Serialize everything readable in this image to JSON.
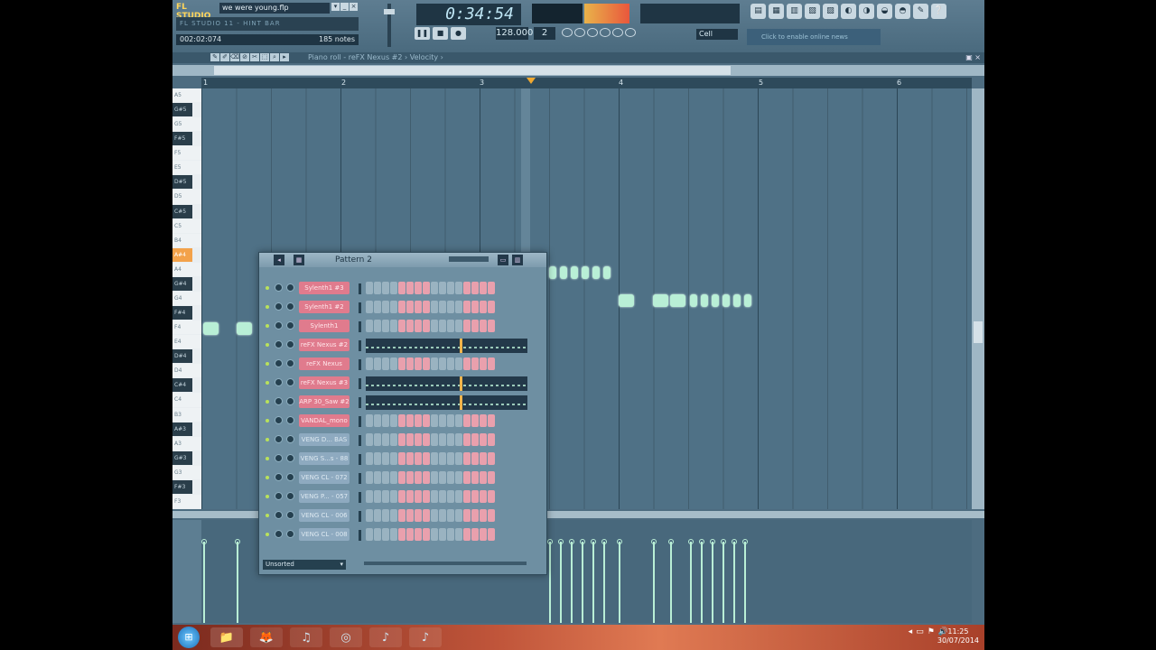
{
  "app": {
    "logo": "FL STUDIO",
    "project_file": "we were young.flp"
  },
  "hint": {
    "text": "FL STUDIO 11 - HINT BAR"
  },
  "position": {
    "time": "002:02:074",
    "notes": "185 notes"
  },
  "transport": {
    "clock": "0:34:54",
    "pause": "❚❚",
    "stop": "■",
    "record": "●",
    "tempo": "128.000",
    "pattern_num": "2"
  },
  "snap": {
    "label": "Cell"
  },
  "news": {
    "text": "Click to enable online news"
  },
  "toolbar_icons": [
    "▤",
    "▦",
    "▥",
    "▧",
    "▨",
    "◐",
    "◑",
    "◒",
    "◓",
    "✎",
    "❔"
  ],
  "piano_roll": {
    "title": "Piano roll - reFX Nexus #2 › Velocity ›",
    "ruler": [
      "1",
      "2",
      "3",
      "4",
      "5",
      "6"
    ]
  },
  "piano_keys": [
    "A5",
    "G#5",
    "G5",
    "F#5",
    "F5",
    "E5",
    "D#5",
    "D5",
    "C#5",
    "C5",
    "B4",
    "A#4",
    "A4",
    "G#4",
    "G4",
    "F#4",
    "F4",
    "E4",
    "D#4",
    "D4",
    "C#4",
    "C4",
    "B3",
    "A#3",
    "A3",
    "G#3",
    "G3",
    "F#3",
    "F3"
  ],
  "sequencer": {
    "title": "Pattern 2",
    "footer": "Unsorted",
    "channels": [
      {
        "name": "Sylenth1 #3",
        "type": "pink"
      },
      {
        "name": "Sylenth1 #2",
        "type": "pink"
      },
      {
        "name": "Sylenth1",
        "type": "pink"
      },
      {
        "name": "reFX Nexus #2",
        "type": "pink",
        "roll": true
      },
      {
        "name": "reFX Nexus",
        "type": "pink"
      },
      {
        "name": "reFX Nexus #3",
        "type": "pink",
        "roll": true
      },
      {
        "name": "ARP 30_Saw #2",
        "type": "pink",
        "roll": true
      },
      {
        "name": "VANDAL_mono",
        "type": "pink"
      },
      {
        "name": "VENG D... BAS",
        "type": "blue"
      },
      {
        "name": "VENG S...s - 88",
        "type": "blue"
      },
      {
        "name": "VENG CL - 072",
        "type": "blue"
      },
      {
        "name": "VENG P... - 057",
        "type": "blue"
      },
      {
        "name": "VENG CL - 006",
        "type": "blue"
      },
      {
        "name": "VENG CL - 008",
        "type": "blue"
      }
    ]
  },
  "taskbar": {
    "start": "⊞",
    "apps": [
      "📁",
      "🦊",
      "♫",
      "◎",
      "♪",
      "♪"
    ],
    "tray": [
      "◂",
      "▭",
      "⚑",
      "🔊"
    ],
    "time": "11:25",
    "date": "30/07/2014"
  },
  "colors": {
    "note": "#b9efd6",
    "pink_channel": "#e07b8d",
    "playhead": "#f0a830"
  }
}
